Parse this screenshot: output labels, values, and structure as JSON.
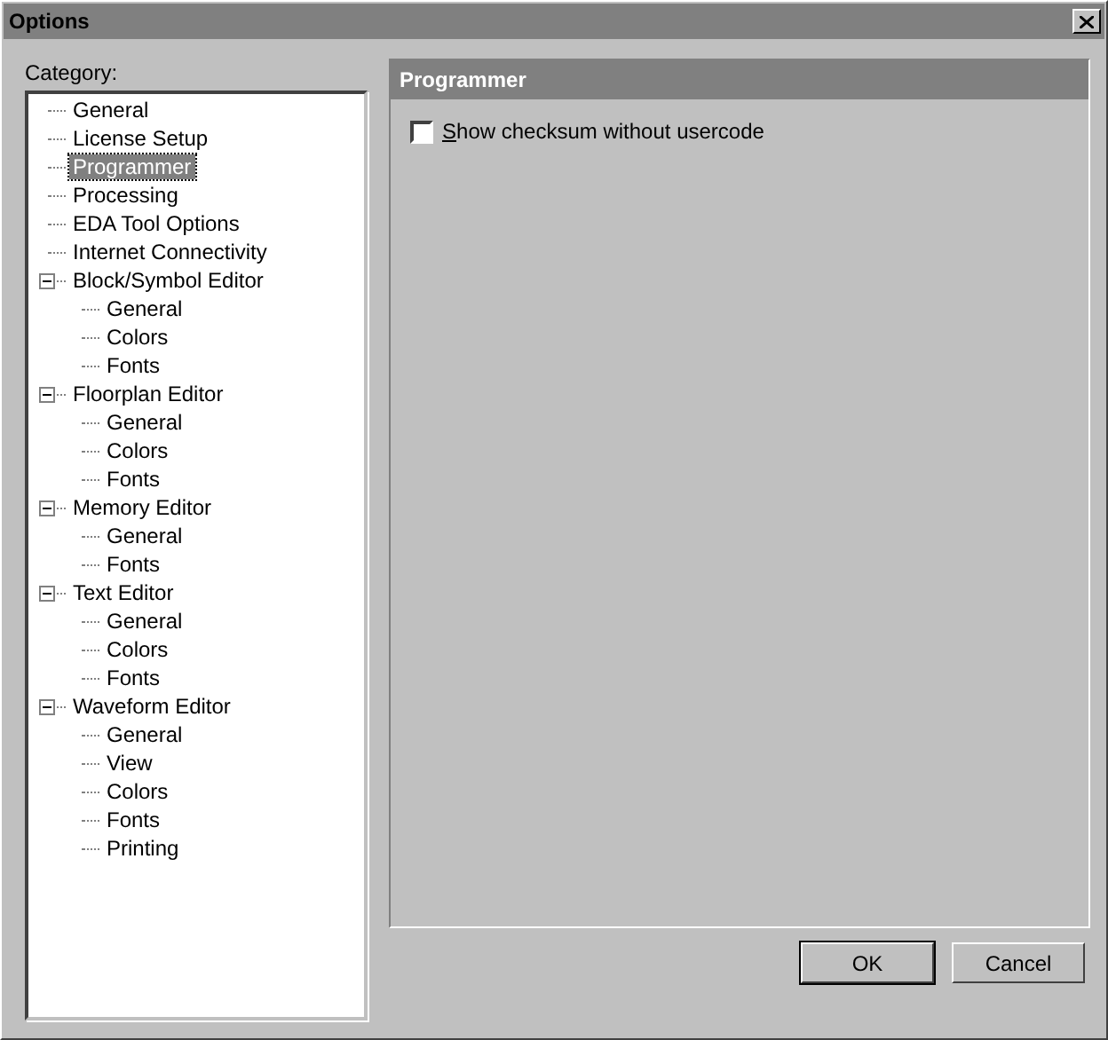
{
  "window": {
    "title": "Options"
  },
  "category_label": "Category:",
  "tree": [
    {
      "label": "General",
      "selected": false
    },
    {
      "label": "License Setup",
      "selected": false
    },
    {
      "label": "Programmer",
      "selected": true
    },
    {
      "label": "Processing",
      "selected": false
    },
    {
      "label": "EDA Tool Options",
      "selected": false
    },
    {
      "label": "Internet Connectivity",
      "selected": false
    },
    {
      "label": "Block/Symbol Editor",
      "selected": false,
      "expanded": true,
      "children": [
        {
          "label": "General",
          "selected": false
        },
        {
          "label": "Colors",
          "selected": false
        },
        {
          "label": "Fonts",
          "selected": false
        }
      ]
    },
    {
      "label": "Floorplan Editor",
      "selected": false,
      "expanded": true,
      "children": [
        {
          "label": "General",
          "selected": false
        },
        {
          "label": "Colors",
          "selected": false
        },
        {
          "label": "Fonts",
          "selected": false
        }
      ]
    },
    {
      "label": "Memory Editor",
      "selected": false,
      "expanded": true,
      "children": [
        {
          "label": "General",
          "selected": false
        },
        {
          "label": "Fonts",
          "selected": false
        }
      ]
    },
    {
      "label": "Text Editor",
      "selected": false,
      "expanded": true,
      "children": [
        {
          "label": "General",
          "selected": false
        },
        {
          "label": "Colors",
          "selected": false
        },
        {
          "label": "Fonts",
          "selected": false
        }
      ]
    },
    {
      "label": "Waveform Editor",
      "selected": false,
      "expanded": true,
      "children": [
        {
          "label": "General",
          "selected": false
        },
        {
          "label": "View",
          "selected": false
        },
        {
          "label": "Colors",
          "selected": false
        },
        {
          "label": "Fonts",
          "selected": false
        },
        {
          "label": "Printing",
          "selected": false
        }
      ]
    }
  ],
  "panel": {
    "title": "Programmer",
    "options": [
      {
        "label": "Show checksum without usercode",
        "checked": false
      }
    ]
  },
  "buttons": [
    "OK",
    "Cancel"
  ]
}
